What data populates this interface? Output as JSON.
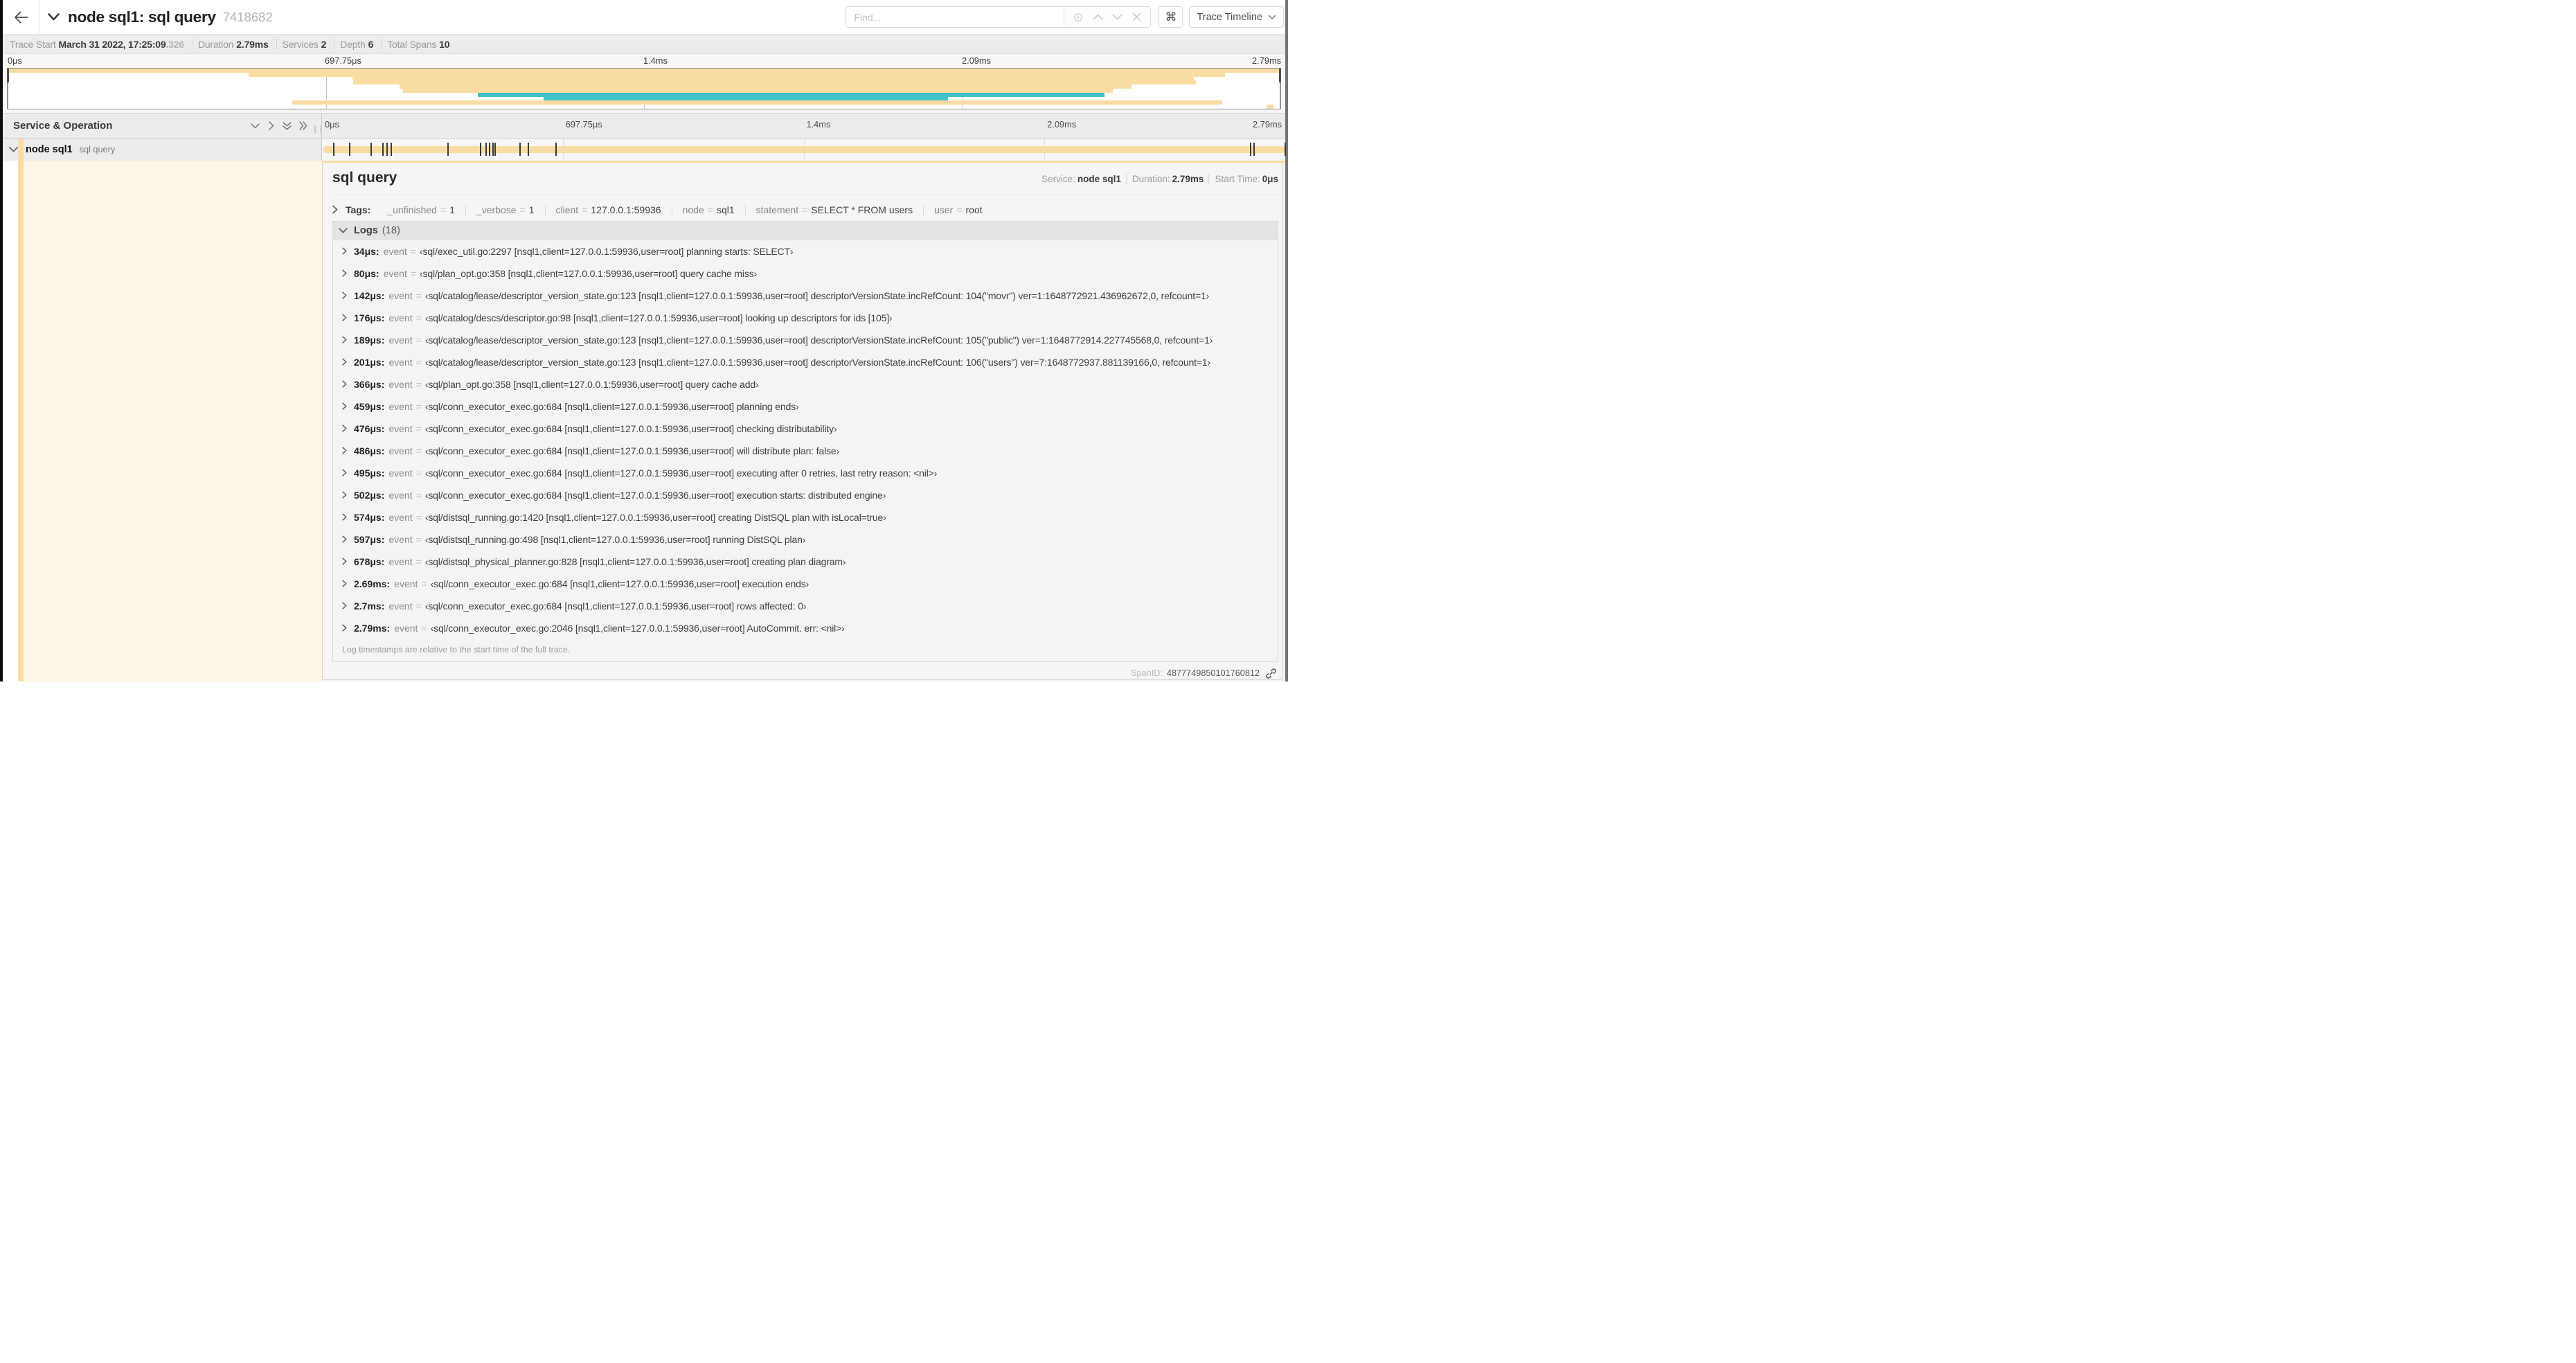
{
  "header": {
    "title": "node sql1: sql query",
    "trace_id": "7418682",
    "find_placeholder": "Find...",
    "keyboard_shortcut": "⌘",
    "view_selector": "Trace Timeline"
  },
  "stats": [
    {
      "label": "Trace Start",
      "value": "March 31 2022, 17:25:09",
      "suffix": ".326"
    },
    {
      "label": "Duration",
      "value": "2.79ms",
      "suffix": ""
    },
    {
      "label": "Services",
      "value": "2",
      "suffix": ""
    },
    {
      "label": "Depth",
      "value": "6",
      "suffix": ""
    },
    {
      "label": "Total Spans",
      "value": "10",
      "suffix": ""
    }
  ],
  "minimap": {
    "tick_labels": [
      "0μs",
      "697.75μs",
      "1.4ms",
      "2.09ms",
      "2.79ms"
    ],
    "spans": [
      {
        "start": 0.0,
        "end": 1.0,
        "color": "#F8DCA1"
      },
      {
        "start": 0.1892,
        "end": 0.9565,
        "color": "#F8DCA1"
      },
      {
        "start": 0.2708,
        "end": 0.9318,
        "color": "#F8DCA1"
      },
      {
        "start": 0.2716,
        "end": 0.9337,
        "color": "#F8DCA1"
      },
      {
        "start": 0.3081,
        "end": 0.8831,
        "color": "#F8DCA1"
      },
      {
        "start": 0.3108,
        "end": 0.8684,
        "color": "#F8DCA1"
      },
      {
        "start": 0.3692,
        "end": 0.8616,
        "color": "#3FC3C9"
      },
      {
        "start": 0.4209,
        "end": 0.739,
        "color": "#3FC3C9"
      },
      {
        "start": 0.2235,
        "end": 0.9541,
        "color": "#F8DCA1"
      },
      {
        "start": 0.9889,
        "end": 0.9945,
        "color": "#F8DCA1"
      }
    ]
  },
  "timeline": {
    "header_title": "Service & Operation",
    "tick_labels": [
      "0μs",
      "697.75μs",
      "1.4ms",
      "2.09ms",
      "2.79ms"
    ],
    "span_row": {
      "service": "node sql1",
      "operation": "sql query",
      "color": "#F8DCA1",
      "duration_us": 2790,
      "log_marker_times_us": [
        34,
        80,
        142,
        176,
        189,
        201,
        366,
        459,
        476,
        486,
        495,
        502,
        574,
        597,
        678,
        2690,
        2700,
        2790
      ]
    }
  },
  "detail": {
    "operation": "sql query",
    "meta": [
      {
        "label": "Service:",
        "value": "node sql1"
      },
      {
        "label": "Duration:",
        "value": "2.79ms"
      },
      {
        "label": "Start Time:",
        "value": "0μs"
      }
    ],
    "tags_label": "Tags:",
    "tags": [
      {
        "key": "_unfinished",
        "value": "1"
      },
      {
        "key": "_verbose",
        "value": "1"
      },
      {
        "key": "client",
        "value": "127.0.0.1:59936"
      },
      {
        "key": "node",
        "value": "sql1"
      },
      {
        "key": "statement",
        "value": "SELECT * FROM users"
      },
      {
        "key": "user",
        "value": "root"
      }
    ],
    "logs": {
      "title": "Logs",
      "count": "(18)",
      "entries": [
        {
          "time": "34μs:",
          "key": "event",
          "value": "‹sql/exec_util.go:2297 [nsql1,client=127.0.0.1:59936,user=root] planning starts: SELECT›"
        },
        {
          "time": "80μs:",
          "key": "event",
          "value": "‹sql/plan_opt.go:358 [nsql1,client=127.0.0.1:59936,user=root] query cache miss›"
        },
        {
          "time": "142μs:",
          "key": "event",
          "value": "‹sql/catalog/lease/descriptor_version_state.go:123 [nsql1,client=127.0.0.1:59936,user=root] descriptorVersionState.incRefCount: 104(\"movr\") ver=1:1648772921.436962672,0, refcount=1›"
        },
        {
          "time": "176μs:",
          "key": "event",
          "value": "‹sql/catalog/descs/descriptor.go:98 [nsql1,client=127.0.0.1:59936,user=root] looking up descriptors for ids [105]›"
        },
        {
          "time": "189μs:",
          "key": "event",
          "value": "‹sql/catalog/lease/descriptor_version_state.go:123 [nsql1,client=127.0.0.1:59936,user=root] descriptorVersionState.incRefCount: 105(\"public\") ver=1:1648772914.227745568,0, refcount=1›"
        },
        {
          "time": "201μs:",
          "key": "event",
          "value": "‹sql/catalog/lease/descriptor_version_state.go:123 [nsql1,client=127.0.0.1:59936,user=root] descriptorVersionState.incRefCount: 106(\"users\") ver=7:1648772937.881139166,0, refcount=1›"
        },
        {
          "time": "366μs:",
          "key": "event",
          "value": "‹sql/plan_opt.go:358 [nsql1,client=127.0.0.1:59936,user=root] query cache add›"
        },
        {
          "time": "459μs:",
          "key": "event",
          "value": "‹sql/conn_executor_exec.go:684 [nsql1,client=127.0.0.1:59936,user=root] planning ends›"
        },
        {
          "time": "476μs:",
          "key": "event",
          "value": "‹sql/conn_executor_exec.go:684 [nsql1,client=127.0.0.1:59936,user=root] checking distributability›"
        },
        {
          "time": "486μs:",
          "key": "event",
          "value": "‹sql/conn_executor_exec.go:684 [nsql1,client=127.0.0.1:59936,user=root] will distribute plan: false›"
        },
        {
          "time": "495μs:",
          "key": "event",
          "value": "‹sql/conn_executor_exec.go:684 [nsql1,client=127.0.0.1:59936,user=root] executing after 0 retries, last retry reason: <nil>›"
        },
        {
          "time": "502μs:",
          "key": "event",
          "value": "‹sql/conn_executor_exec.go:684 [nsql1,client=127.0.0.1:59936,user=root] execution starts: distributed engine›"
        },
        {
          "time": "574μs:",
          "key": "event",
          "value": "‹sql/distsql_running.go:1420 [nsql1,client=127.0.0.1:59936,user=root] creating DistSQL plan with isLocal=true›"
        },
        {
          "time": "597μs:",
          "key": "event",
          "value": "‹sql/distsql_running.go:498 [nsql1,client=127.0.0.1:59936,user=root] running DistSQL plan›"
        },
        {
          "time": "678μs:",
          "key": "event",
          "value": "‹sql/distsql_physical_planner.go:828 [nsql1,client=127.0.0.1:59936,user=root] creating plan diagram›"
        },
        {
          "time": "2.69ms:",
          "key": "event",
          "value": "‹sql/conn_executor_exec.go:684 [nsql1,client=127.0.0.1:59936,user=root] execution ends›"
        },
        {
          "time": "2.7ms:",
          "key": "event",
          "value": "‹sql/conn_executor_exec.go:684 [nsql1,client=127.0.0.1:59936,user=root] rows affected: 0›"
        },
        {
          "time": "2.79ms:",
          "key": "event",
          "value": "‹sql/conn_executor_exec.go:2046 [nsql1,client=127.0.0.1:59936,user=root] AutoCommit. err: <nil>›"
        }
      ],
      "footer": "Log timestamps are relative to the start time of the full trace."
    },
    "span_id_label": "SpanID:",
    "span_id": "4877749850101760812"
  },
  "colors": {
    "service_primary": "#F8DCA1",
    "service_secondary": "#3FC3C9",
    "detail_tint": "rgba(248,220,161,0.32)"
  }
}
